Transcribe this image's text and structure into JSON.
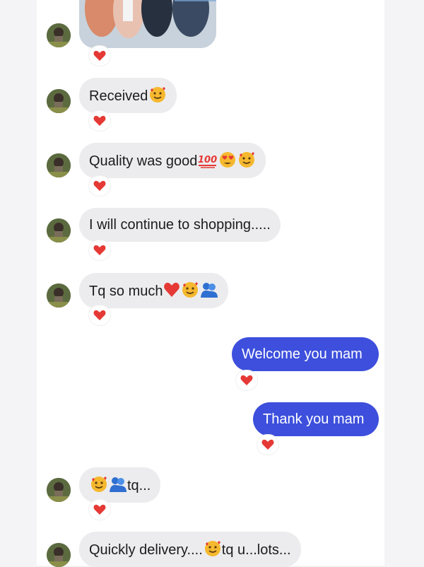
{
  "accent_color": "#3d4fdc",
  "heart_color": "#e53935",
  "messages": [
    {
      "from": "them",
      "kind": "photo",
      "icon": "sandals-photo",
      "reaction": "heart-icon"
    },
    {
      "from": "them",
      "text": "Received",
      "emoji": [
        "smiling-face-with-hearts-icon"
      ],
      "reaction": "heart-icon"
    },
    {
      "from": "them",
      "text": "Quality was good",
      "emoji": [
        "hundred-points-icon",
        "heart-eyes-icon",
        "smiling-face-with-hearts-icon"
      ],
      "reaction": "heart-icon"
    },
    {
      "from": "them",
      "text": "I will continue to shopping.....",
      "emoji": [],
      "reaction": "heart-icon"
    },
    {
      "from": "them",
      "text": "Tq so much",
      "emoji": [
        "red-heart-icon",
        "smiling-face-with-hearts-icon",
        "people-hugging-icon"
      ],
      "reaction": "heart-icon"
    },
    {
      "from": "me",
      "text": "Welcome you mam",
      "reaction": "heart-icon"
    },
    {
      "from": "me",
      "text": "Thank you mam",
      "reaction": "heart-icon"
    },
    {
      "from": "them",
      "text": "tq...",
      "emoji_before": [
        "smiling-face-with-hearts-icon",
        "people-hugging-icon"
      ],
      "reaction": "heart-icon"
    },
    {
      "from": "them",
      "text_a": "Quickly delivery....",
      "text_b": "tq u...lots...",
      "emoji_mid": [
        "smiling-face-with-hearts-icon"
      ]
    }
  ]
}
